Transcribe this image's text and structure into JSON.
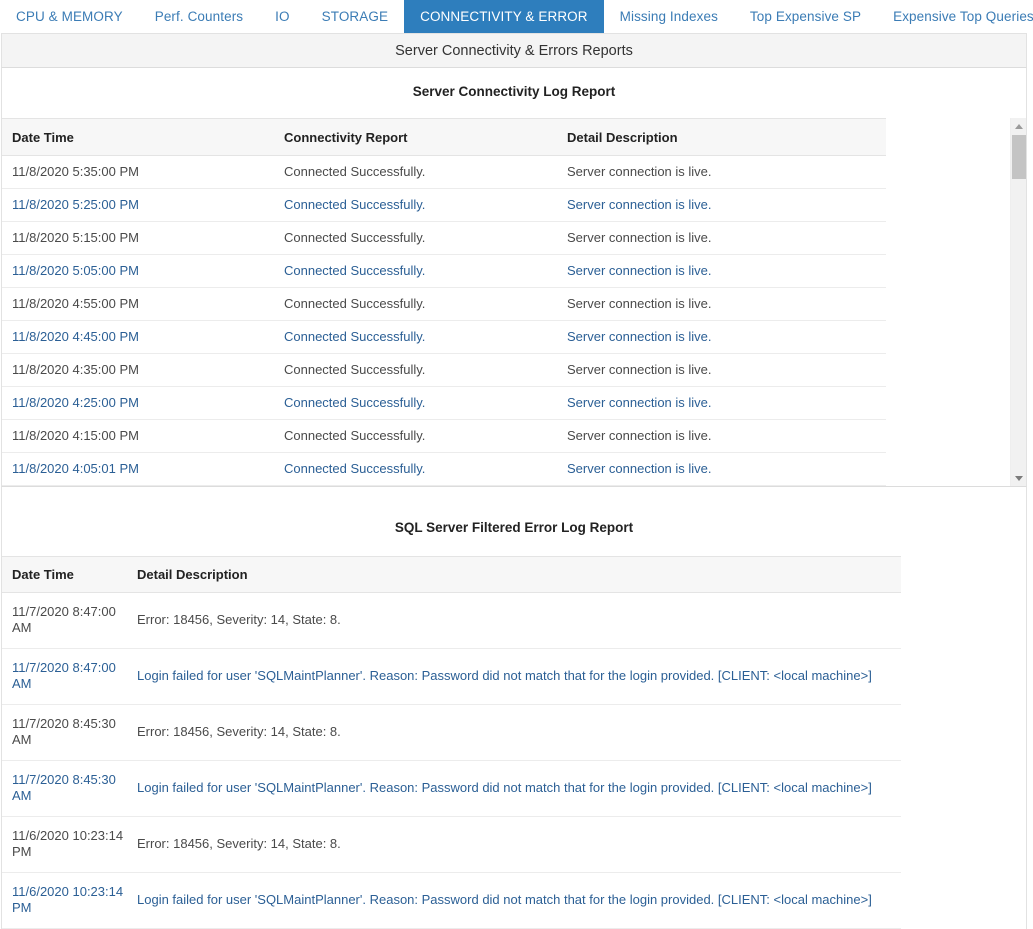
{
  "colors": {
    "accent": "#2e7ebd",
    "tab_text": "#3b7cb5",
    "row_text": "#4a4a4a",
    "row_alt_text": "#2b5f95",
    "header_bg": "#f7f7f7",
    "subtitle_bg": "#f4f4f4"
  },
  "tabs": [
    {
      "label": "CPU & MEMORY",
      "active": false,
      "caret": false
    },
    {
      "label": "Perf. Counters",
      "active": false,
      "caret": false
    },
    {
      "label": "IO",
      "active": false,
      "caret": false
    },
    {
      "label": "STORAGE",
      "active": false,
      "caret": false
    },
    {
      "label": "CONNECTIVITY & ERROR",
      "active": true,
      "caret": false
    },
    {
      "label": "Missing Indexes",
      "active": false,
      "caret": false
    },
    {
      "label": "Top Expensive SP",
      "active": false,
      "caret": false
    },
    {
      "label": "Expensive Top Queries",
      "active": false,
      "caret": true
    }
  ],
  "subtitle": "Server Connectivity & Errors Reports",
  "connectivity_report": {
    "title": "Server Connectivity Log Report",
    "columns": [
      "Date Time",
      "Connectivity Report",
      "Detail Description"
    ],
    "rows": [
      [
        "11/8/2020 5:35:00 PM",
        "Connected Successfully.",
        "Server connection is live."
      ],
      [
        "11/8/2020 5:25:00 PM",
        "Connected Successfully.",
        "Server connection is live."
      ],
      [
        "11/8/2020 5:15:00 PM",
        "Connected Successfully.",
        "Server connection is live."
      ],
      [
        "11/8/2020 5:05:00 PM",
        "Connected Successfully.",
        "Server connection is live."
      ],
      [
        "11/8/2020 4:55:00 PM",
        "Connected Successfully.",
        "Server connection is live."
      ],
      [
        "11/8/2020 4:45:00 PM",
        "Connected Successfully.",
        "Server connection is live."
      ],
      [
        "11/8/2020 4:35:00 PM",
        "Connected Successfully.",
        "Server connection is live."
      ],
      [
        "11/8/2020 4:25:00 PM",
        "Connected Successfully.",
        "Server connection is live."
      ],
      [
        "11/8/2020 4:15:00 PM",
        "Connected Successfully.",
        "Server connection is live."
      ],
      [
        "11/8/2020 4:05:01 PM",
        "Connected Successfully.",
        "Server connection is live."
      ]
    ],
    "scrollbar": {
      "up_arrow_icon": "triangle-up-icon",
      "down_arrow_icon": "triangle-down-icon"
    }
  },
  "error_report": {
    "title": "SQL Server Filtered Error Log Report",
    "columns": [
      "Date Time",
      "Detail Description"
    ],
    "rows": [
      [
        "11/7/2020 8:47:00 AM",
        "Error: 18456, Severity: 14, State: 8."
      ],
      [
        "11/7/2020 8:47:00 AM",
        "Login failed for user 'SQLMaintPlanner'. Reason: Password did not match that for the login provided. [CLIENT: <local machine>]"
      ],
      [
        "11/7/2020 8:45:30 AM",
        "Error: 18456, Severity: 14, State: 8."
      ],
      [
        "11/7/2020 8:45:30 AM",
        "Login failed for user 'SQLMaintPlanner'. Reason: Password did not match that for the login provided. [CLIENT: <local machine>]"
      ],
      [
        "11/6/2020 10:23:14 PM",
        "Error: 18456, Severity: 14, State: 8."
      ],
      [
        "11/6/2020 10:23:14 PM",
        "Login failed for user 'SQLMaintPlanner'. Reason: Password did not match that for the login provided. [CLIENT: <local machine>]"
      ]
    ]
  }
}
